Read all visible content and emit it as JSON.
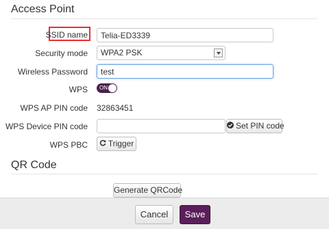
{
  "access_point": {
    "title": "Access Point",
    "ssid": {
      "label": "SSID name",
      "value": "Telia-ED3339"
    },
    "security": {
      "label": "Security mode",
      "value": "WPA2 PSK"
    },
    "password": {
      "label": "Wireless Password",
      "value": "test"
    },
    "wps": {
      "label": "WPS",
      "toggle_text": "ON",
      "on": true
    },
    "wps_ap_pin": {
      "label": "WPS AP PIN code",
      "value": "32863451"
    },
    "wps_device_pin": {
      "label": "WPS Device PIN code",
      "value": "",
      "button": "Set PIN code"
    },
    "wps_pbc": {
      "label": "WPS PBC",
      "button": "Trigger"
    }
  },
  "qr": {
    "title": "QR Code",
    "generate_button": "Generate QRCode"
  },
  "footer": {
    "cancel_label": "Cancel",
    "save_label": "Save"
  },
  "colors": {
    "accent": "#5a1f5a",
    "highlight": "#e8302f",
    "focus": "#6ea6e0",
    "footer_bg": "#ececec"
  },
  "icons": {
    "set_pin": "check-circle-icon",
    "trigger": "refresh-icon",
    "select_arrow": "chevron-down-icon"
  }
}
